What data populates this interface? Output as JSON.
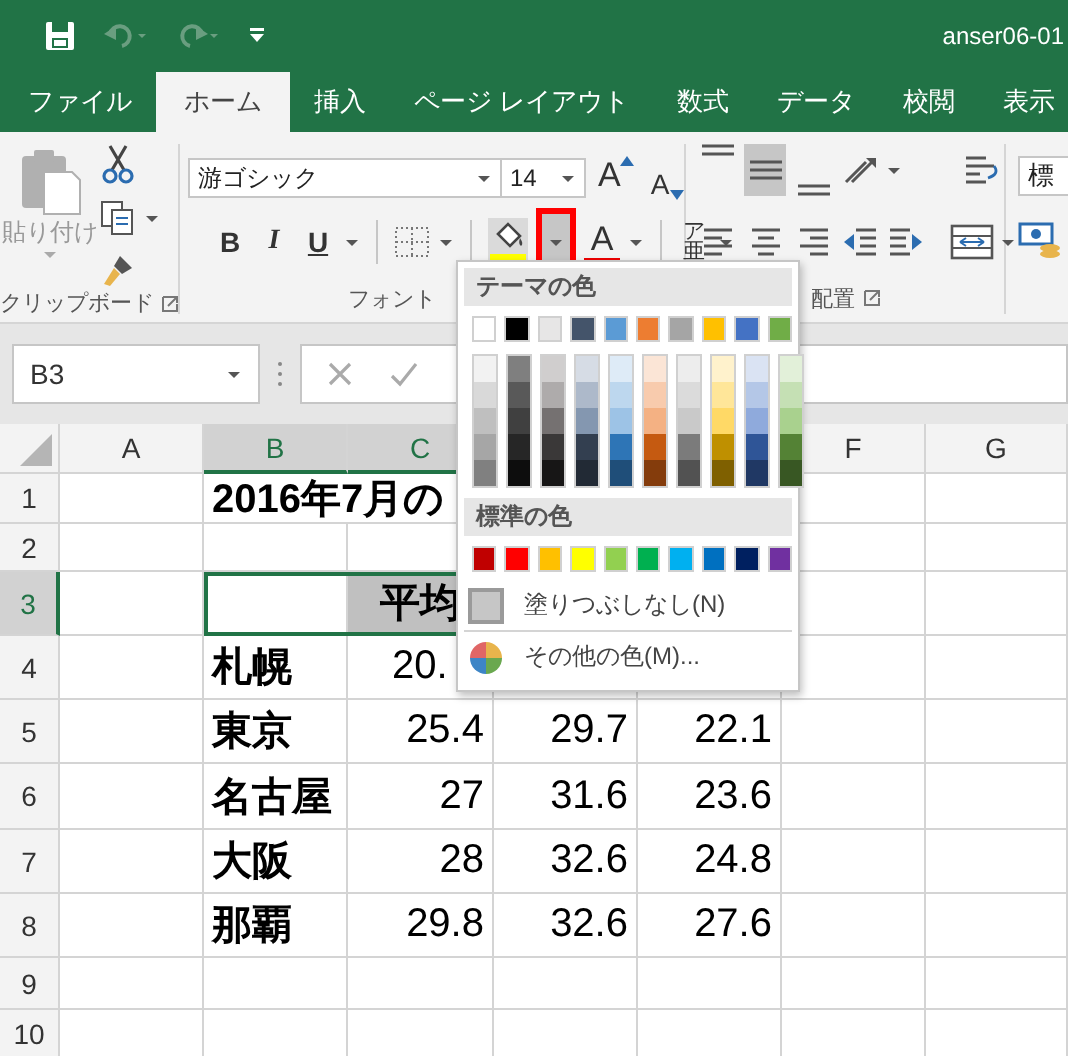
{
  "window": {
    "title": "anser06-01"
  },
  "tabs": [
    {
      "label": "ファイル",
      "selected": false
    },
    {
      "label": "ホーム",
      "selected": true
    },
    {
      "label": "挿入",
      "selected": false
    },
    {
      "label": "ページ レイアウト",
      "selected": false
    },
    {
      "label": "数式",
      "selected": false
    },
    {
      "label": "データ",
      "selected": false
    },
    {
      "label": "校閲",
      "selected": false
    },
    {
      "label": "表示",
      "selected": false
    }
  ],
  "ribbon": {
    "clipboard": {
      "paste": {
        "label": "貼り付け",
        "disabled": true
      },
      "group_label": "クリップボード"
    },
    "font": {
      "font_name": "游ゴシック",
      "font_size": "14",
      "grow": "A",
      "shrink": "A",
      "bold": "B",
      "italic": "I",
      "underline": "U",
      "fill_dropdown": {
        "highlighted": true
      },
      "font_color": "A",
      "phonetic_small": "ア",
      "phonetic": "亜",
      "group_label": "フォント"
    },
    "alignment": {
      "vertical": [
        {
          "kind": "top",
          "selected": false
        },
        {
          "kind": "middle",
          "selected": true
        },
        {
          "kind": "bottom",
          "selected": false
        }
      ],
      "horizontal": [
        {
          "kind": "left",
          "selected": false
        },
        {
          "kind": "center",
          "selected": false
        },
        {
          "kind": "right",
          "selected": false
        }
      ],
      "group_label": "配置"
    },
    "number": {
      "format": "標"
    }
  },
  "formula_bar": {
    "name_box": "B3"
  },
  "columns": [
    {
      "kind": "header",
      "label": "A",
      "selected": false
    },
    {
      "kind": "header",
      "label": "B",
      "selected": true
    },
    {
      "kind": "header",
      "label": "C",
      "selected": true
    },
    {
      "kind": "covered"
    },
    {
      "kind": "covered"
    },
    {
      "kind": "header",
      "label": "F",
      "selected": false
    },
    {
      "kind": "header",
      "label": "G",
      "selected": false
    }
  ],
  "rows": [
    {
      "label": "1",
      "selected": false,
      "title": "2016年7月の"
    },
    {
      "label": "2",
      "selected": false
    },
    {
      "label": "3",
      "selected": true,
      "header": "平均"
    },
    {
      "label": "4",
      "selected": false,
      "name": "札幌",
      "partial": "20."
    },
    {
      "label": "5",
      "selected": false,
      "name": "東京",
      "values": [
        "25.4",
        "29.7",
        "22.1"
      ]
    },
    {
      "label": "6",
      "selected": false,
      "name": "名古屋",
      "values": [
        "27",
        "31.6",
        "23.6"
      ]
    },
    {
      "label": "7",
      "selected": false,
      "name": "大阪",
      "values": [
        "28",
        "32.6",
        "24.8"
      ]
    },
    {
      "label": "8",
      "selected": false,
      "name": "那覇",
      "values": [
        "29.8",
        "32.6",
        "27.6"
      ]
    },
    {
      "label": "9",
      "selected": false
    },
    {
      "label": "10",
      "selected": false
    }
  ],
  "fill_menu": {
    "theme_heading": "テーマの色",
    "theme_colors": [
      {
        "color": "#ffffff",
        "shades": [
          {
            "color": "#f2f2f2"
          },
          {
            "color": "#d9d9d9"
          },
          {
            "color": "#bfbfbf"
          },
          {
            "color": "#a6a6a6"
          },
          {
            "color": "#808080"
          }
        ]
      },
      {
        "color": "#000000",
        "shades": [
          {
            "color": "#7f7f7f"
          },
          {
            "color": "#595959"
          },
          {
            "color": "#404040"
          },
          {
            "color": "#262626"
          },
          {
            "color": "#0d0d0d"
          }
        ]
      },
      {
        "color": "#e7e6e6",
        "shades": [
          {
            "color": "#d0cece"
          },
          {
            "color": "#aeabab"
          },
          {
            "color": "#757171"
          },
          {
            "color": "#3a3838"
          },
          {
            "color": "#171616"
          }
        ]
      },
      {
        "color": "#44546a",
        "shades": [
          {
            "color": "#d6dce5"
          },
          {
            "color": "#adb9ca"
          },
          {
            "color": "#8497b0"
          },
          {
            "color": "#333f50"
          },
          {
            "color": "#222a35"
          }
        ]
      },
      {
        "color": "#5b9bd5",
        "shades": [
          {
            "color": "#deebf7"
          },
          {
            "color": "#bdd7ee"
          },
          {
            "color": "#9dc3e6"
          },
          {
            "color": "#2e75b6"
          },
          {
            "color": "#1f4e79"
          }
        ]
      },
      {
        "color": "#ed7d31",
        "shades": [
          {
            "color": "#fbe5d6"
          },
          {
            "color": "#f8cbad"
          },
          {
            "color": "#f4b183"
          },
          {
            "color": "#c55a11"
          },
          {
            "color": "#843c0c"
          }
        ]
      },
      {
        "color": "#a5a5a5",
        "shades": [
          {
            "color": "#ededed"
          },
          {
            "color": "#dbdbdb"
          },
          {
            "color": "#c9c9c9"
          },
          {
            "color": "#7b7b7b"
          },
          {
            "color": "#525252"
          }
        ]
      },
      {
        "color": "#ffc000",
        "shades": [
          {
            "color": "#fff2cc"
          },
          {
            "color": "#ffe699"
          },
          {
            "color": "#ffd966"
          },
          {
            "color": "#bf9000"
          },
          {
            "color": "#7f6000"
          }
        ]
      },
      {
        "color": "#4472c4",
        "shades": [
          {
            "color": "#dae3f3"
          },
          {
            "color": "#b4c7e7"
          },
          {
            "color": "#8faadc"
          },
          {
            "color": "#2f5597"
          },
          {
            "color": "#203864"
          }
        ]
      },
      {
        "color": "#70ad47",
        "shades": [
          {
            "color": "#e2f0d9"
          },
          {
            "color": "#c5e0b4"
          },
          {
            "color": "#a9d18e"
          },
          {
            "color": "#548235"
          },
          {
            "color": "#385723"
          }
        ]
      }
    ],
    "standard_heading": "標準の色",
    "standard_colors": [
      {
        "color": "#c00000"
      },
      {
        "color": "#ff0000"
      },
      {
        "color": "#ffc000"
      },
      {
        "color": "#ffff00"
      },
      {
        "color": "#92d050"
      },
      {
        "color": "#00b050"
      },
      {
        "color": "#00b0f0"
      },
      {
        "color": "#0070c0"
      },
      {
        "color": "#002060"
      },
      {
        "color": "#7030a0"
      }
    ],
    "items": [
      {
        "kind": "no-fill",
        "label": "塗りつぶしなし(N)"
      },
      {
        "kind": "more-colors",
        "label": "その他の色(M)..."
      }
    ]
  }
}
